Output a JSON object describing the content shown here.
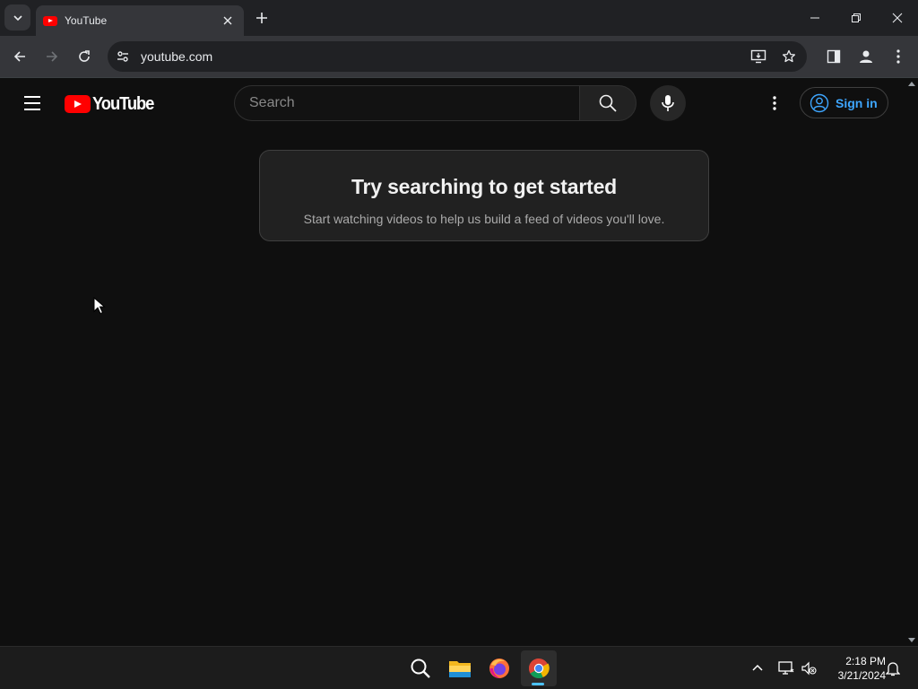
{
  "browser": {
    "tab": {
      "title": "YouTube"
    },
    "address": {
      "url": "youtube.com"
    }
  },
  "youtube": {
    "logo": "YouTube",
    "search": {
      "placeholder": "Search"
    },
    "signin_label": "Sign in",
    "prompt": {
      "title": "Try searching to get started",
      "subtitle": "Start watching videos to help us build a feed of videos you'll love."
    }
  },
  "taskbar": {
    "apps": [
      "search-icon",
      "file-explorer-icon",
      "firefox-icon",
      "chrome-icon"
    ],
    "active_app": "chrome",
    "clock": {
      "time": "2:18 PM",
      "date": "3/21/2024"
    }
  },
  "colors": {
    "page_bg": "#0f0f0f",
    "brand_red": "#ff0000",
    "link_blue": "#3ea6ff",
    "card_bg": "#212121"
  }
}
